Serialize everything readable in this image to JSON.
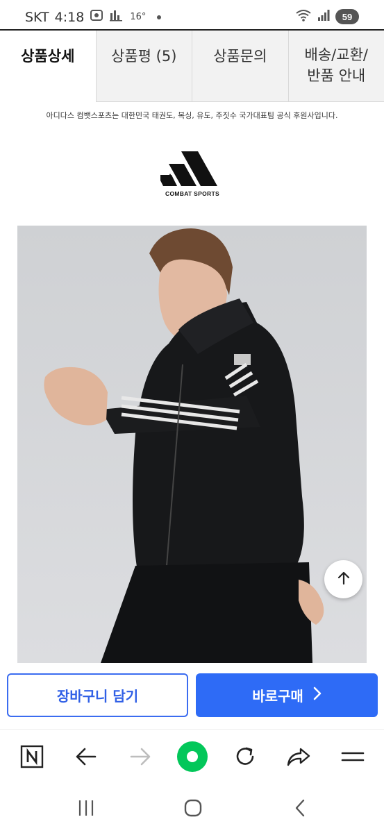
{
  "status_bar": {
    "carrier": "SKT",
    "time": "4:18",
    "temperature": "16°",
    "battery": "59"
  },
  "tabs": [
    {
      "label": "상품상세",
      "active": true
    },
    {
      "label": "상품평 (5)",
      "active": false
    },
    {
      "label": "상품문의",
      "active": false
    },
    {
      "label": "배송/교환/\n반품 안내",
      "active": false
    }
  ],
  "content": {
    "notice": "아디다스 컴뱃스포츠는 대한민국 태권도, 복싱, 유도, 주짓수 국가대표팀 공식 후원사입니다.",
    "logo_caption": "COMBAT SPORTS"
  },
  "actions": {
    "cart_label": "장바구니 담기",
    "buy_label": "바로구매"
  },
  "browser_toolbar": {
    "icons": [
      "naver-icon",
      "back-icon",
      "forward-icon",
      "green-dot-icon",
      "refresh-icon",
      "share-icon",
      "menu-icon"
    ]
  },
  "colors": {
    "accent": "#2e6bf6",
    "green": "#03c75a"
  }
}
